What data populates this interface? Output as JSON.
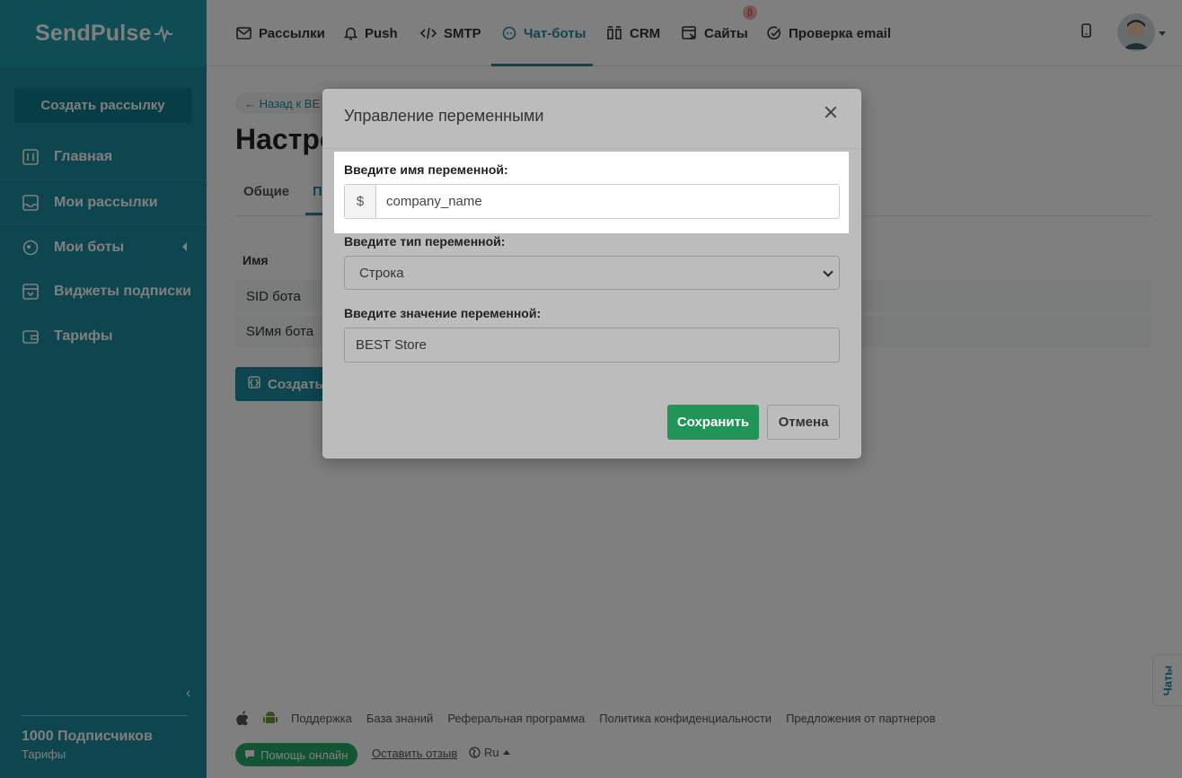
{
  "brand": {
    "logo_text": "SendPulse"
  },
  "sidebar": {
    "create_button": "Создать рассылку",
    "items": [
      {
        "label": "Главная",
        "icon": "dashboard-icon"
      },
      {
        "label": "Мои рассылки",
        "icon": "inbox-icon"
      },
      {
        "label": "Мои боты",
        "icon": "bot-icon"
      },
      {
        "label": "Виджеты подписки",
        "icon": "widget-icon"
      },
      {
        "label": "Тарифы",
        "icon": "wallet-icon"
      }
    ],
    "subscribers": "1000 Подписчиков",
    "plan_link": "Тарифы"
  },
  "topnav": {
    "tabs": [
      {
        "label": "Рассылки",
        "icon": "envelope-icon"
      },
      {
        "label": "Push",
        "icon": "bell-icon"
      },
      {
        "label": "SMTP",
        "icon": "code-icon"
      },
      {
        "label": "Чат-боты",
        "icon": "chat-icon",
        "active": true
      },
      {
        "label": "CRM",
        "icon": "crm-icon"
      },
      {
        "label": "Сайты",
        "icon": "site-icon"
      },
      {
        "label": "Проверка email",
        "icon": "check-circle-icon"
      }
    ],
    "beta_badge": "β"
  },
  "page": {
    "back_link": "← Назад к BE",
    "title": "Настро",
    "subtabs": [
      "Общие",
      "П"
    ],
    "table_header": "Имя",
    "rows": [
      "SID бота",
      "SИмя бота"
    ],
    "create_button": "Создать"
  },
  "footer": {
    "links": [
      "Поддержка",
      "База знаний",
      "Реферальная программа",
      "Политика конфиденциальности",
      "Предложения от партнеров"
    ],
    "help_button": "Помощь онлайн",
    "feedback": "Оставить отзыв",
    "language": "Ru",
    "chats_tab": "Чаты"
  },
  "modal": {
    "title": "Управление переменными",
    "name_label": "Введите имя переменной:",
    "name_prefix": "$",
    "name_value": "company_name",
    "type_label": "Введите тип переменной:",
    "type_value": "Строка",
    "value_label": "Введите значение переменной:",
    "value_value": "BEST Store",
    "save_button": "Сохранить",
    "cancel_button": "Отмена"
  },
  "colors": {
    "sidebar": "#1c8d9e",
    "accent": "#1c8d9e",
    "save": "#219458"
  }
}
